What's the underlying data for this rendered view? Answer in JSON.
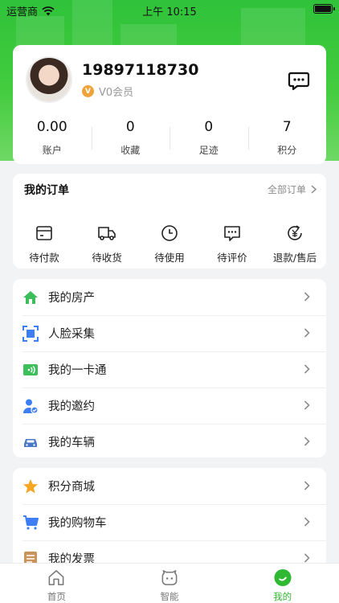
{
  "status": {
    "carrier": "运营商",
    "time": "上午 10:15"
  },
  "profile": {
    "phone": "19897118730",
    "member_level": "V0会员"
  },
  "stats": [
    {
      "value": "0.00",
      "label": "账户"
    },
    {
      "value": "0",
      "label": "收藏"
    },
    {
      "value": "0",
      "label": "足迹"
    },
    {
      "value": "7",
      "label": "积分"
    }
  ],
  "orders": {
    "title": "我的订单",
    "all_label": "全部订单",
    "items": [
      {
        "label": "待付款",
        "icon": "wallet-icon"
      },
      {
        "label": "待收货",
        "icon": "truck-icon"
      },
      {
        "label": "待使用",
        "icon": "clock-icon"
      },
      {
        "label": "待评价",
        "icon": "comment-icon"
      },
      {
        "label": "退款/售后",
        "icon": "refund-icon"
      }
    ]
  },
  "menu1": [
    {
      "label": "我的房产",
      "icon": "house-icon",
      "color": "#3cbf5b"
    },
    {
      "label": "人脸采集",
      "icon": "face-scan-icon",
      "color": "#3d7ef5"
    },
    {
      "label": "我的一卡通",
      "icon": "nfc-card-icon",
      "color": "#3cbf5b"
    },
    {
      "label": "我的邀约",
      "icon": "user-invite-icon",
      "color": "#3d7ef5"
    },
    {
      "label": "我的车辆",
      "icon": "car-icon",
      "color": "#4a78c8"
    }
  ],
  "menu2": [
    {
      "label": "积分商城",
      "icon": "star-icon",
      "color": "#f5a623"
    },
    {
      "label": "我的购物车",
      "icon": "cart-icon",
      "color": "#3d7ef5"
    },
    {
      "label": "我的发票",
      "icon": "invoice-icon",
      "color": "#c8945a"
    }
  ],
  "tabs": [
    {
      "label": "首页",
      "icon": "home-icon"
    },
    {
      "label": "智能",
      "icon": "smart-icon"
    },
    {
      "label": "我的",
      "icon": "profile-icon"
    }
  ],
  "colors": {
    "accent": "#2fb832",
    "hero": "#3ec63c"
  }
}
